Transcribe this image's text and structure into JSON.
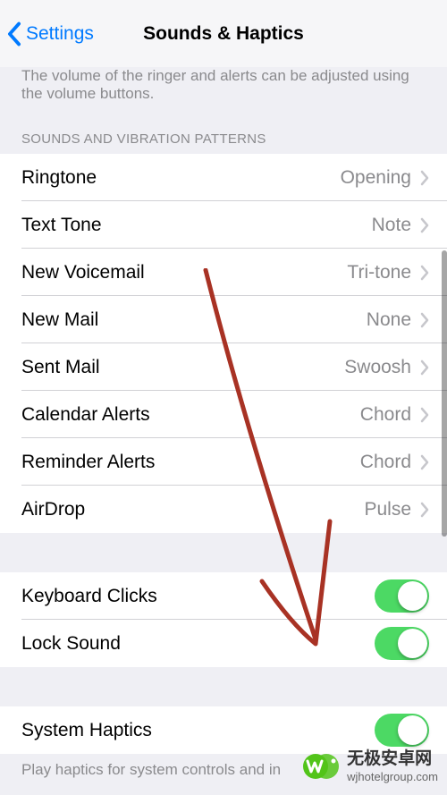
{
  "nav": {
    "back_label": "Settings",
    "title": "Sounds & Haptics"
  },
  "footer_cut": "The volume of the ringer and alerts can be adjusted using the volume buttons.",
  "sections": {
    "sounds_header": "SOUNDS AND VIBRATION PATTERNS"
  },
  "rows": {
    "ringtone": {
      "label": "Ringtone",
      "value": "Opening"
    },
    "text_tone": {
      "label": "Text Tone",
      "value": "Note"
    },
    "new_voicemail": {
      "label": "New Voicemail",
      "value": "Tri-tone"
    },
    "new_mail": {
      "label": "New Mail",
      "value": "None"
    },
    "sent_mail": {
      "label": "Sent Mail",
      "value": "Swoosh"
    },
    "calendar": {
      "label": "Calendar Alerts",
      "value": "Chord"
    },
    "reminder": {
      "label": "Reminder Alerts",
      "value": "Chord"
    },
    "airdrop": {
      "label": "AirDrop",
      "value": "Pulse"
    },
    "keyboard": {
      "label": "Keyboard Clicks"
    },
    "lock": {
      "label": "Lock Sound"
    },
    "haptics": {
      "label": "System Haptics"
    }
  },
  "haptics_footer": "Play haptics for system controls and in",
  "watermark": {
    "cn": "无极安卓网",
    "url": "wjhotelgroup.com"
  }
}
